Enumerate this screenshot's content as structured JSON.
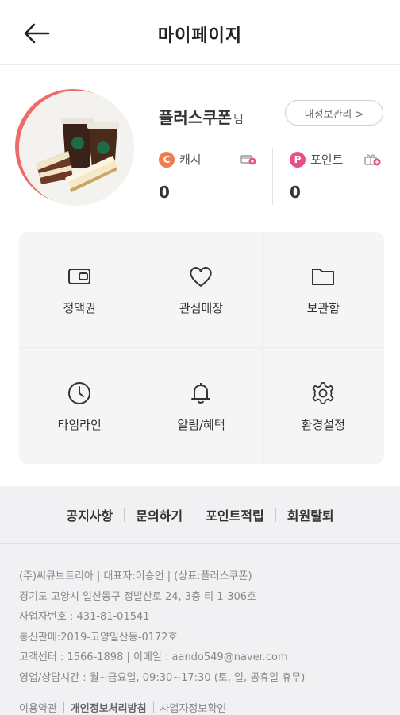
{
  "header": {
    "title": "마이페이지"
  },
  "profile": {
    "nickname": "플러스쿠폰",
    "suffix": "님",
    "info_button": "내정보관리 >",
    "cash": {
      "label": "캐시",
      "badge": "C",
      "amount": "0"
    },
    "point": {
      "label": "포인트",
      "badge": "P",
      "amount": "0"
    }
  },
  "menu": [
    {
      "label": "정액권",
      "icon": "wallet-icon"
    },
    {
      "label": "관심매장",
      "icon": "heart-icon"
    },
    {
      "label": "보관함",
      "icon": "folder-icon"
    },
    {
      "label": "타임라인",
      "icon": "clock-icon"
    },
    {
      "label": "알림/혜택",
      "icon": "bell-icon"
    },
    {
      "label": "환경설정",
      "icon": "gear-icon"
    }
  ],
  "links": [
    "공지사항",
    "문의하기",
    "포인트적립",
    "회원탈퇴"
  ],
  "footer": {
    "lines": [
      "(주)씨큐브트리아 | 대표자:이승언 | (상표:플러스쿠폰)",
      "경기도 고양시 일산동구 정발산로 24, 3층 티 1-306호",
      "사업자번호 : 431-81-01541",
      "통신판매:2019-고양일산동-0172호",
      "고객센터 : 1566-1898 | 이메일 : aando549@naver.com",
      "영업/상담시간 : 월~금요일, 09:30~17:30 (토, 일, 공휴일 휴무)"
    ],
    "policy": [
      "이용약관",
      "개인정보처리방침",
      "사업자정보확인"
    ]
  },
  "colors": {
    "cash_badge": "#f4794e",
    "point_badge": "#e8508a",
    "avatar_ring": "#ef6b6b"
  }
}
